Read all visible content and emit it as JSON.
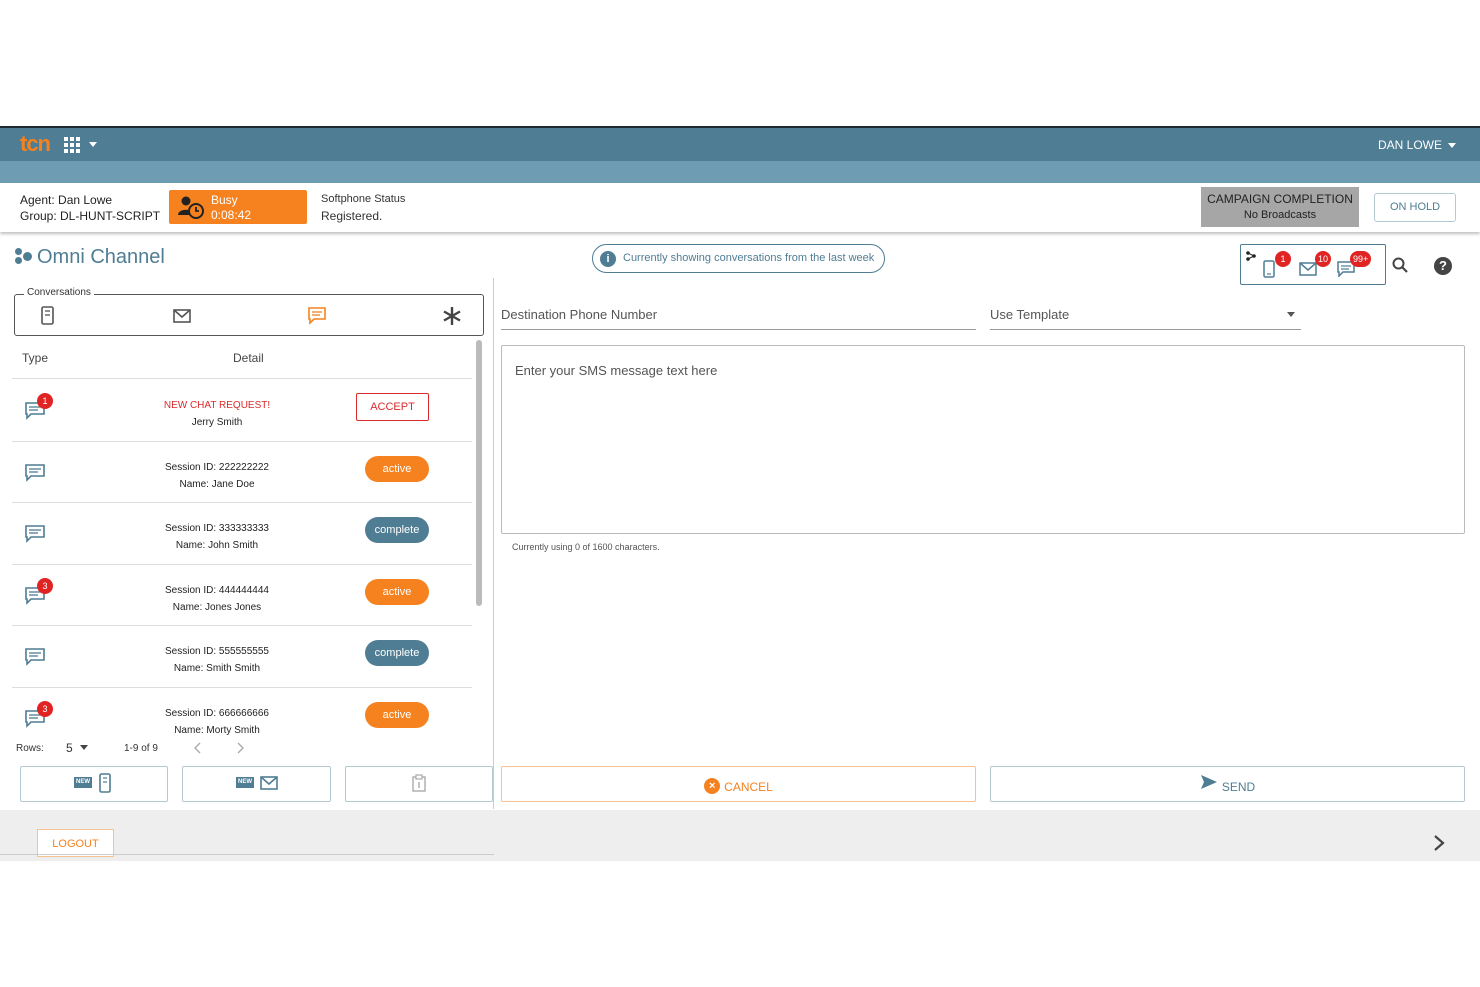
{
  "topbar": {
    "logo": "tcn",
    "user": "DAN LOWE"
  },
  "agent": {
    "agent_line": "Agent: Dan Lowe",
    "group_line": "Group: DL-HUNT-SCRIPT"
  },
  "status": {
    "label": "Busy",
    "timer": "0:08:42"
  },
  "softphone": {
    "label": "Softphone Status",
    "value": "Registered."
  },
  "campaign": {
    "title": "CAMPAIGN COMPLETION",
    "subtitle": "No Broadcasts"
  },
  "onhold_label": "ON HOLD",
  "omni": {
    "title": "Omni Channel"
  },
  "info_banner": "Currently showing conversations from the last week",
  "notifications": {
    "sms_count": "1",
    "email_count": "10",
    "chat_count": "99+"
  },
  "conversations": {
    "legend": "Conversations",
    "headers": {
      "type": "Type",
      "detail": "Detail"
    },
    "rows": [
      {
        "badge": "1",
        "line1": "NEW CHAT REQUEST!",
        "line2": "Jerry Smith",
        "action": "ACCEPT"
      },
      {
        "badge": "",
        "line1": "Session ID: 222222222",
        "line2": "Name: Jane Doe",
        "status": "active"
      },
      {
        "badge": "",
        "line1": "Session ID: 333333333",
        "line2": "Name: John Smith",
        "status": "complete"
      },
      {
        "badge": "3",
        "line1": "Session ID: 444444444",
        "line2": "Name: Jones Jones",
        "status": "active"
      },
      {
        "badge": "",
        "line1": "Session ID: 555555555",
        "line2": "Name: Smith Smith",
        "status": "complete"
      },
      {
        "badge": "3",
        "line1": "Session ID: 666666666",
        "line2": "Name: Morty Smith",
        "status": "active"
      }
    ],
    "pager": {
      "rows_label": "Rows:",
      "rows_value": "5",
      "range": "1-9 of 9"
    }
  },
  "new_buttons": {
    "tag": "NEW"
  },
  "compose": {
    "dest_placeholder": "Destination Phone Number",
    "template_placeholder": "Use Template",
    "sms_placeholder": "Enter your SMS message text here",
    "char_count": "Currently using 0 of 1600 characters.",
    "cancel_label": "CANCEL",
    "send_label": "SEND"
  },
  "footer": {
    "logout_label": "LOGOUT"
  },
  "colors": {
    "brand_orange": "#f5821f",
    "header_blue": "#4f7d93",
    "badge_red": "#e02424"
  }
}
